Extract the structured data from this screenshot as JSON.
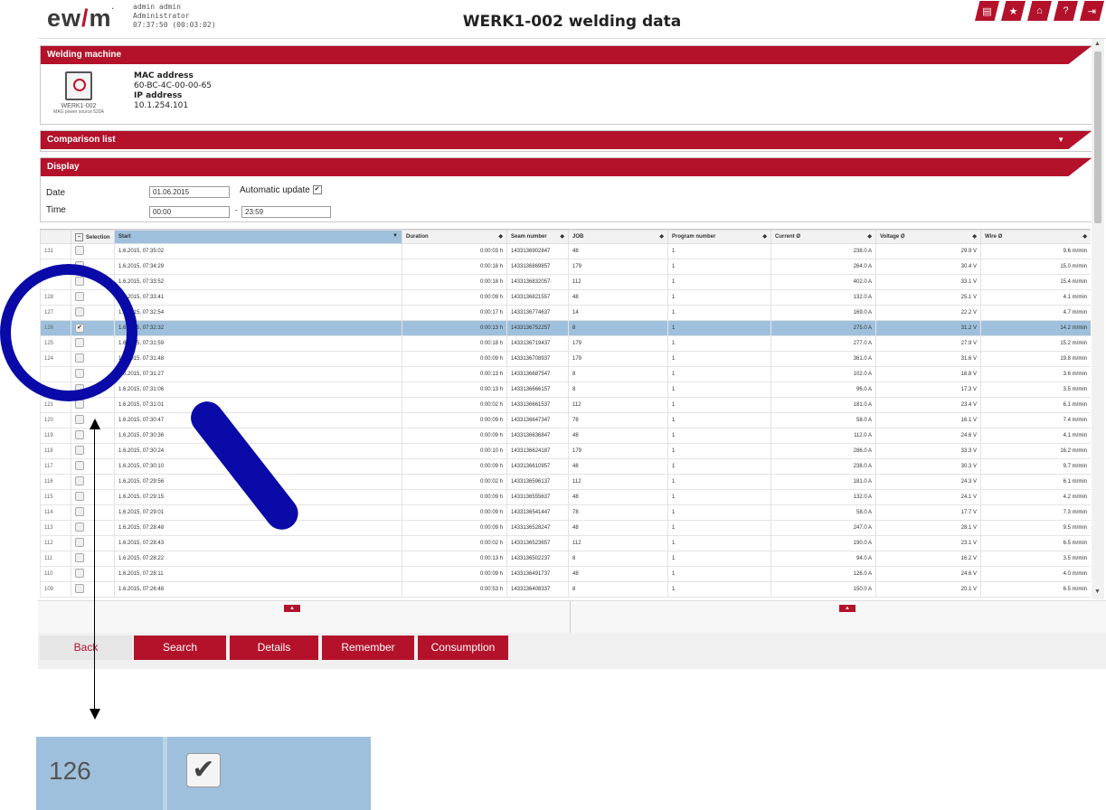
{
  "header": {
    "logo": "ewm",
    "user_name": "admin admin",
    "user_role": "Administrator",
    "clock": "07:37:50 (00:03:02)",
    "title": "WERK1-002 welding data",
    "icons": [
      "print-icon",
      "star-icon",
      "home-icon",
      "help-icon",
      "exit-icon"
    ]
  },
  "machine_panel": {
    "title": "Welding machine",
    "machine_name": "WERK1-002",
    "machine_type": "MAG power source 520A",
    "mac_label": "MAC address",
    "mac_value": "60-BC-4C-00-00-65",
    "ip_label": "IP address",
    "ip_value": "10.1.254.101"
  },
  "comparison_panel": {
    "title": "Comparison list"
  },
  "display_panel": {
    "title": "Display",
    "date_label": "Date",
    "date_value": "01.06.2015",
    "auto_update_label": "Automatic update",
    "time_label": "Time",
    "time_from": "00:00",
    "time_sep": "-",
    "time_to": "23:59"
  },
  "table": {
    "columns": [
      "Selection",
      "Start",
      "Duration",
      "Seam number",
      "JOB",
      "Program number",
      "Current Ø",
      "Voltage Ø",
      "Wire Ø"
    ],
    "rows": [
      [
        "131",
        "1.6.2015, 07:35:02",
        "0:00:03 h",
        "1433136902847",
        "48",
        "1",
        "238.0 A",
        "29.9 V",
        "9.6 m/min"
      ],
      [
        "",
        "1.6.2015, 07:34:29",
        "0:00:18 h",
        "1433136869857",
        "179",
        "1",
        "264.0 A",
        "30.4 V",
        "15.0 m/min"
      ],
      [
        "",
        "1.6.2015, 07:33:52",
        "0:00:18 h",
        "1433136832057",
        "112",
        "1",
        "402.0 A",
        "33.1 V",
        "15.4 m/min"
      ],
      [
        "128",
        "1.6.2015, 07:33:41",
        "0:00:09 h",
        "1433136821557",
        "48",
        "1",
        "132.0 A",
        "25.1 V",
        "4.1 m/min"
      ],
      [
        "127",
        "1.6.2015, 07:32:54",
        "0:00:17 h",
        "1433136774637",
        "14",
        "1",
        "169.0 A",
        "22.2 V",
        "4.7 m/min"
      ],
      [
        "126",
        "1.6.2015, 07:32:32",
        "0:00:13 h",
        "1433136752257",
        "8",
        "1",
        "275.0 A",
        "31.2 V",
        "14.2 m/min"
      ],
      [
        "125",
        "1.6.2015, 07:31:59",
        "0:00:18 h",
        "1433136719437",
        "179",
        "1",
        "277.0 A",
        "27.9 V",
        "15.2 m/min"
      ],
      [
        "124",
        "1.6.2015, 07:31:48",
        "0:00:09 h",
        "1433136708937",
        "179",
        "1",
        "361.0 A",
        "31.6 V",
        "19.8 m/min"
      ],
      [
        "",
        "1.6.2015, 07:31:27",
        "0:00:13 h",
        "1433136687547",
        "8",
        "1",
        "102.0 A",
        "16.8 V",
        "3.6 m/min"
      ],
      [
        "",
        "1.6.2015, 07:31:06",
        "0:00:13 h",
        "1433136666157",
        "8",
        "1",
        "96.0 A",
        "17.3 V",
        "3.5 m/min"
      ],
      [
        "121",
        "1.6.2015, 07:31:01",
        "0:00:02 h",
        "1433136661537",
        "112",
        "1",
        "181.0 A",
        "23.4 V",
        "6.1 m/min"
      ],
      [
        "120",
        "1.6.2015, 07:30:47",
        "0:00:09 h",
        "1433136647347",
        "78",
        "1",
        "58.0 A",
        "16.1 V",
        "7.4 m/min"
      ],
      [
        "119",
        "1.6.2015, 07:30:36",
        "0:00:09 h",
        "1433136636847",
        "48",
        "1",
        "112.0 A",
        "24.6 V",
        "4.1 m/min"
      ],
      [
        "118",
        "1.6.2015, 07:30:24",
        "0:00:10 h",
        "1433136624187",
        "179",
        "1",
        "286.0 A",
        "33.3 V",
        "16.2 m/min"
      ],
      [
        "117",
        "1.6.2015, 07:30:10",
        "0:00:09 h",
        "1433136610957",
        "48",
        "1",
        "238.0 A",
        "30.3 V",
        "9.7 m/min"
      ],
      [
        "116",
        "1.6.2015, 07:29:56",
        "0:00:02 h",
        "1433136596137",
        "112",
        "1",
        "181.0 A",
        "24.3 V",
        "6.1 m/min"
      ],
      [
        "115",
        "1.6.2015, 07:29:15",
        "0:00:09 h",
        "1433136555637",
        "48",
        "1",
        "132.0 A",
        "24.1 V",
        "4.2 m/min"
      ],
      [
        "114",
        "1.6.2015, 07:29:01",
        "0:00:09 h",
        "1433136541447",
        "78",
        "1",
        "58.0 A",
        "17.7 V",
        "7.3 m/min"
      ],
      [
        "113",
        "1.6.2015, 07:28:48",
        "0:00:09 h",
        "1433136528247",
        "48",
        "1",
        "247.0 A",
        "28.1 V",
        "9.5 m/min"
      ],
      [
        "112",
        "1.6.2015, 07:28:43",
        "0:00:02 h",
        "1433136523657",
        "112",
        "1",
        "190.0 A",
        "23.1 V",
        "6.5 m/min"
      ],
      [
        "111",
        "1.6.2015, 07:28:22",
        "0:00:13 h",
        "1433136502237",
        "8",
        "1",
        "94.0 A",
        "16.2 V",
        "3.5 m/min"
      ],
      [
        "110",
        "1.6.2015, 07:28:11",
        "0:00:09 h",
        "1433136491737",
        "48",
        "1",
        "126.0 A",
        "24.6 V",
        "4.0 m/min"
      ],
      [
        "109",
        "1.6.2015, 07:26:48",
        "0:00:53 h",
        "1433136408337",
        "8",
        "1",
        "150.0 A",
        "20.1 V",
        "6.5 m/min"
      ]
    ],
    "selected_row": 5
  },
  "buttons": {
    "back": "Back",
    "search": "Search",
    "details": "Details",
    "remember": "Remember",
    "consumption": "Consumption"
  },
  "zoom": {
    "row_number": "126"
  },
  "colors": {
    "brand_red": "#b3122a",
    "selection_blue": "#9ec0dc",
    "magnifier": "#0a0aa8"
  }
}
